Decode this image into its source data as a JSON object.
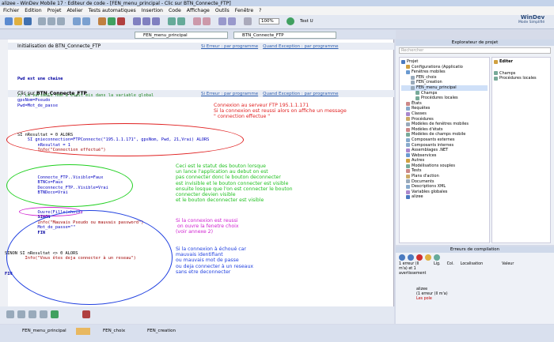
{
  "window": {
    "title": "alizee - WinDev Mobile 17 · Editeur de code - [FEN_menu_principal - Clic sur BTN_Connecte_FTP]"
  },
  "menu": [
    "Fichier",
    "Edition",
    "Projet",
    "Atelier",
    "Tests automatiques",
    "Insertion",
    "Code",
    "Affichage",
    "Outils",
    "Fenêtre",
    "?"
  ],
  "toolbar": {
    "zoom": "100%",
    "test_label": "Test U"
  },
  "brand": {
    "name": "WinDev",
    "sub": "Mode Simplifié"
  },
  "combos": {
    "window": "FEN_menu_principal",
    "control": "BTN_Connecte_FTP"
  },
  "sections": {
    "init": {
      "title": "Initialisation de BTN_Connecte_FTP",
      "link1": "Si Erreur : par programme",
      "link2": "Quand Exception : par programme"
    },
    "click": {
      "title_prefix": "Clic sur ",
      "title_bold": "BTN_Connecte_FTP",
      "link1": "Si Erreur : par programme",
      "link2": "Quand Exception : par programme"
    }
  },
  "code": {
    "l1": "Pwd est une chaine",
    "l2": "// La variable nom a etait mis dans la variable global",
    "l3": "gpsNom=Pseudo",
    "l4": "Pwd=Mot_de_passe",
    "l5": "SI nResultat = 0 ALORS",
    "l6": "    SI gnieconnection=FTPConnecte(\"195.1.1.171\", gpsNom, Pwd, 21,Vrai) ALORS",
    "l7": "        nResultat = 1",
    "l8": "        Info(\"Connection effectué\")",
    "l9": "        Connecte_FTP..Visible=Faux",
    "l10": "        BTNCo=Faux",
    "l11": "        Deconnecte_FTP..Visible=Vrai",
    "l12": "        BTNDeco=Vrai",
    "l13": "        Ouvre(Fille(choix)",
    "l14": "        SINON",
    "l15": "        Info(\"Mauvais Pseudo ou mauvais password\")",
    "l16": "        Mot_de_passe=\"\"",
    "l17": "        FIN",
    "l18": "SINON SI nResultat <> 0 ALORS",
    "l19": "        Info(\"Vous êtes deja connecter à un reseau\")",
    "l20": "FIN"
  },
  "notes": {
    "red1": "Connexion au serveur FTP 195.1.1.171\nSi la connexion est reussi alors on affiche un message\n\" connection effectue \"",
    "green": "Ceci est le statut des bouton lorsque\nun lance l'application au debut on est\npas connecter donc le bouton deconnecter\nest invisible et le bouton connecter est visible\nensuite losque que l'on est connecter le bouton\nconnecter devien visible\net le bouton deconnecter est visible",
    "pink": "Si la connexion est reussi\n on ouvre la fenetre choix\n(voir annexe 2)",
    "blue": "Si la connexion à échoué car\nmauvais identifiant\nou mauvais mot de passe\nou deja connecter à un reseaux\nsans etre deconnecter"
  },
  "explorer": {
    "title": "Explorateur de projet",
    "search": "Rechercher",
    "tree": [
      "Projet",
      "Configurations (Applicatio",
      "Fenêtres mobiles",
      "FEN_choix",
      "FEN_creation",
      "FEN_menu_principal",
      "Champs",
      "Procédures locales",
      "États",
      "Requêtes",
      "Classes",
      "Procédures",
      "Modèles de fenêtres mobiles",
      "Modèles d'états",
      "Modèles de champs mobile",
      "Composants externes",
      "Composants internes",
      "Assemblages .NET",
      "Webservices",
      "Autres",
      "Modélisations souples",
      "Tests",
      "Plans d'action",
      "Documents",
      "Descriptions XML",
      "Variables globales",
      "alizee"
    ],
    "detail_header": "Editer",
    "detail_items": [
      "Champs",
      "Procédures locales"
    ]
  },
  "errors": {
    "title": "Erreurs de compilation",
    "col_left": "1 erreur (Il m'a) et 1 avertissement",
    "columns": [
      "Lig.",
      "Col.",
      "Localisation",
      "Valeur"
    ],
    "rows": [
      "alizee",
      "(1 erreur (Il m'a)",
      "Les pole"
    ]
  },
  "tasks": [
    "FEN_menu_principal",
    "",
    "FEN_choix",
    "FEN_creation"
  ]
}
